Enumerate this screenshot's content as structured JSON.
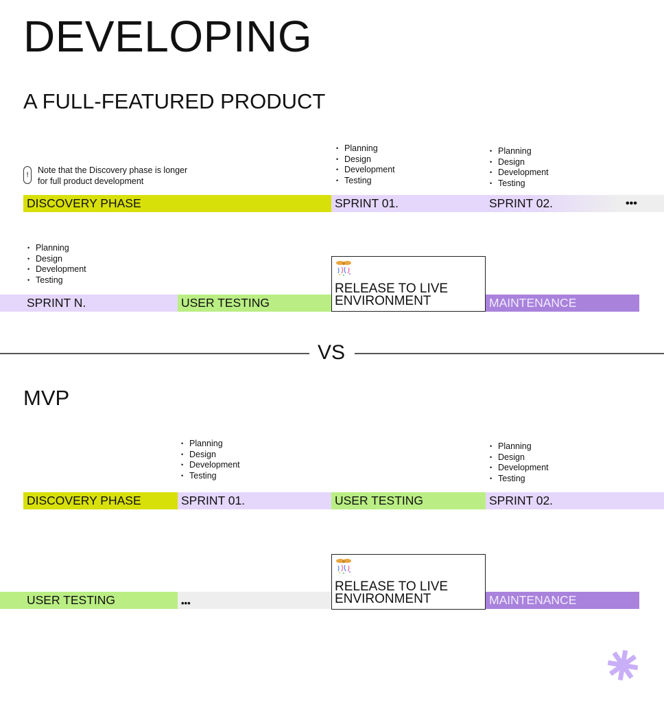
{
  "title": "DEVELOPING",
  "sections": {
    "full_product": {
      "heading": "A FULL-FEATURED PRODUCT",
      "note": {
        "icon": "exclamation-icon",
        "line1": "Note that the Discovery phase is longer",
        "line2": "for full product development"
      },
      "row1": {
        "discovery": "DISCOVERY PHASE",
        "sprint01": "SPRINT 01.",
        "sprint02": "SPRINT 02.",
        "more": "•••"
      },
      "row2": {
        "sprint_n": "SPRINT N.",
        "user_testing": "USER TESTING",
        "release_line1": "RELEASE TO LIVE",
        "release_line2": "ENVIRONMENT",
        "maintenance": "MAINTENANCE"
      },
      "sprint01_tasks": [
        "Planning",
        "Design",
        "Development",
        "Testing"
      ],
      "sprint02_tasks": [
        "Planning",
        "Design",
        "Development",
        "Testing"
      ],
      "sprint_n_tasks": [
        "Planning",
        "Design",
        "Development",
        "Testing"
      ]
    },
    "divider": {
      "label": "VS"
    },
    "mvp": {
      "heading": "MVP",
      "row1": {
        "discovery": "DISCOVERY PHASE",
        "sprint01": "SPRINT 01.",
        "user_testing": "USER TESTING",
        "sprint02": "SPRINT 02."
      },
      "row2": {
        "user_testing": "USER TESTING",
        "more": "•••",
        "release_line1": "RELEASE TO LIVE",
        "release_line2": "ENVIRONMENT",
        "maintenance": "MAINTENANCE"
      },
      "sprint01_tasks": [
        "Planning",
        "Design",
        "Development",
        "Testing"
      ],
      "sprint02_tasks": [
        "Planning",
        "Design",
        "Development",
        "Testing"
      ]
    }
  },
  "icons": {
    "release": "gift-confetti-icon",
    "brand": "asterisk-icon"
  },
  "colors": {
    "discovery": "#d8e00a",
    "sprint": "#e5d7fc",
    "user_testing": "#baee84",
    "maintenance": "#a982dc",
    "more": "#eeeeee",
    "brand_asterisk": "#c9aef8"
  }
}
